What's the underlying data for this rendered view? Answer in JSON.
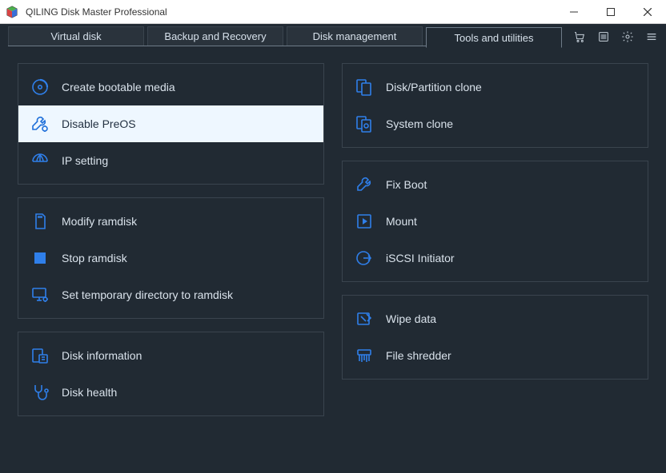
{
  "window": {
    "title": "QILING Disk Master Professional"
  },
  "tabs": {
    "items": [
      {
        "label": "Virtual disk"
      },
      {
        "label": "Backup and Recovery"
      },
      {
        "label": "Disk management"
      },
      {
        "label": "Tools and utilities"
      }
    ],
    "active_index": 3
  },
  "left_column": {
    "group1": {
      "items": [
        {
          "label": "Create bootable media",
          "icon": "disc"
        },
        {
          "label": "Disable PreOS",
          "icon": "wrench-gear",
          "selected": true
        },
        {
          "label": "IP setting",
          "icon": "globe-net"
        }
      ]
    },
    "group2": {
      "items": [
        {
          "label": "Modify ramdisk",
          "icon": "sd-card"
        },
        {
          "label": "Stop ramdisk",
          "icon": "stop-square"
        },
        {
          "label": "Set temporary directory to ramdisk",
          "icon": "monitor-gear"
        }
      ]
    },
    "group3": {
      "items": [
        {
          "label": "Disk information",
          "icon": "disk-info"
        },
        {
          "label": "Disk health",
          "icon": "stethoscope"
        }
      ]
    }
  },
  "right_column": {
    "group1": {
      "items": [
        {
          "label": "Disk/Partition clone",
          "icon": "clone-disk"
        },
        {
          "label": "System clone",
          "icon": "clone-sys"
        }
      ]
    },
    "group2": {
      "items": [
        {
          "label": "Fix Boot",
          "icon": "wrench"
        },
        {
          "label": "Mount",
          "icon": "play-box"
        },
        {
          "label": "iSCSI Initiator",
          "icon": "circle-arrow"
        }
      ]
    },
    "group3": {
      "items": [
        {
          "label": "Wipe data",
          "icon": "eraser"
        },
        {
          "label": "File shredder",
          "icon": "shredder"
        }
      ]
    }
  }
}
